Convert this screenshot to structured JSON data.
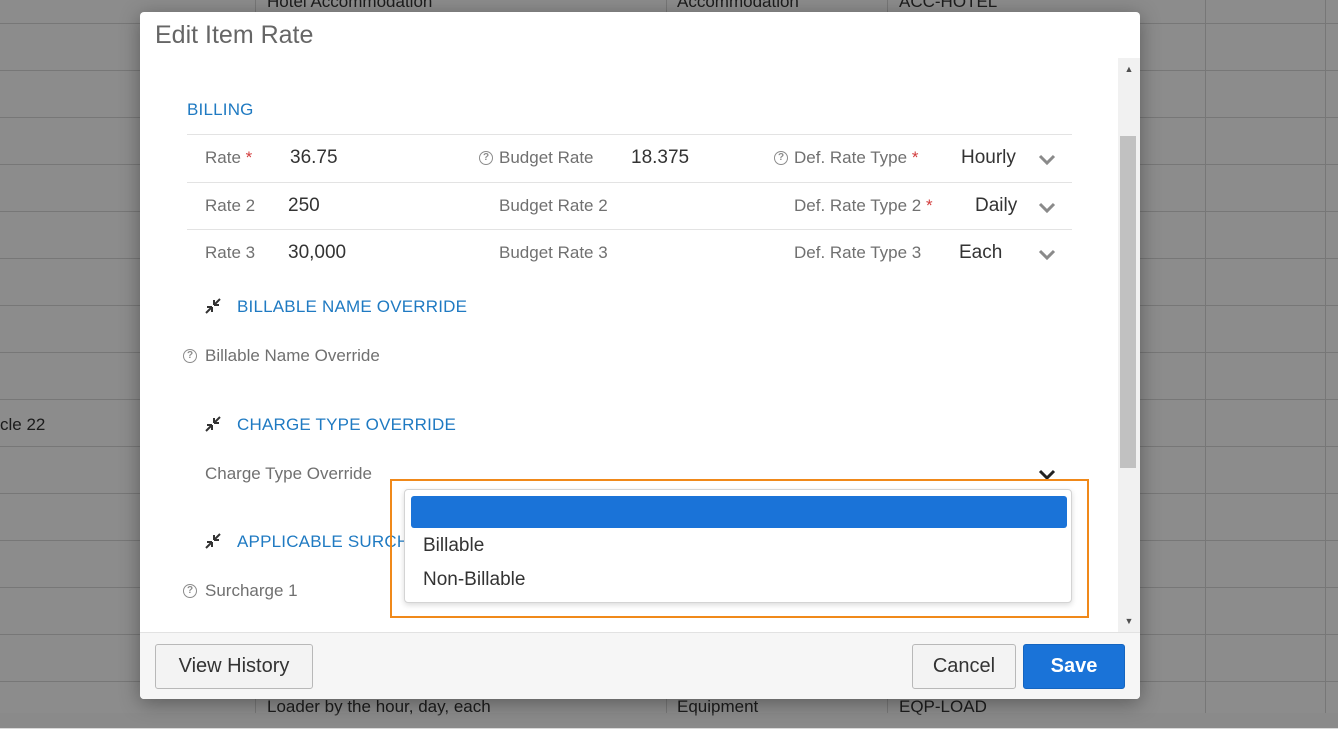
{
  "background": {
    "cells": [
      {
        "text": "Hotel Accommodation"
      },
      {
        "text": "Accommodation"
      },
      {
        "text": "ACC-HOTEL"
      },
      {
        "text": "cle 22"
      },
      {
        "text": "Loader by the hour, day, each"
      },
      {
        "text": "Equipment"
      },
      {
        "text": "EQP-LOAD"
      }
    ]
  },
  "modal": {
    "title": "Edit Item Rate",
    "billing": {
      "title": "BILLING",
      "rows": [
        {
          "rate_label": "Rate",
          "rate_required": true,
          "rate_value": "36.75",
          "budget_label": "Budget Rate",
          "budget_help": true,
          "budget_value": "18.375",
          "type_label": "Def. Rate Type",
          "type_help": true,
          "type_required": true,
          "type_value": "Hourly"
        },
        {
          "rate_label": "Rate 2",
          "rate_required": false,
          "rate_value": "250",
          "budget_label": "Budget Rate 2",
          "budget_help": false,
          "budget_value": "",
          "type_label": "Def. Rate Type 2",
          "type_help": false,
          "type_required": true,
          "type_value": "Daily"
        },
        {
          "rate_label": "Rate 3",
          "rate_required": false,
          "rate_value": "30,000",
          "budget_label": "Budget Rate 3",
          "budget_help": false,
          "budget_value": "",
          "type_label": "Def. Rate Type 3",
          "type_help": false,
          "type_required": false,
          "type_value": "Each"
        }
      ]
    },
    "billable_name_override": {
      "title": "BILLABLE NAME OVERRIDE",
      "field_label": "Billable Name Override"
    },
    "charge_type_override": {
      "title": "CHARGE TYPE OVERRIDE",
      "field_label": "Charge Type Override",
      "options": [
        "",
        "Billable",
        "Non-Billable"
      ],
      "highlighted_index": 0
    },
    "applicable_surcharges": {
      "title": "APPLICABLE SURCHA",
      "field_label": "Surcharge 1"
    },
    "footer": {
      "view_history": "View History",
      "cancel": "Cancel",
      "save": "Save"
    }
  },
  "colors": {
    "accent": "#1a73d8",
    "section_title": "#1f7ac2",
    "required": "#d23c3c",
    "highlight_outline": "#f0891a"
  },
  "icons": {
    "help": "question-circle-icon",
    "collapse": "compress-arrows-icon",
    "chevron": "chevron-down-icon",
    "scroll_up": "triangle-up-icon",
    "scroll_down": "triangle-down-icon"
  }
}
